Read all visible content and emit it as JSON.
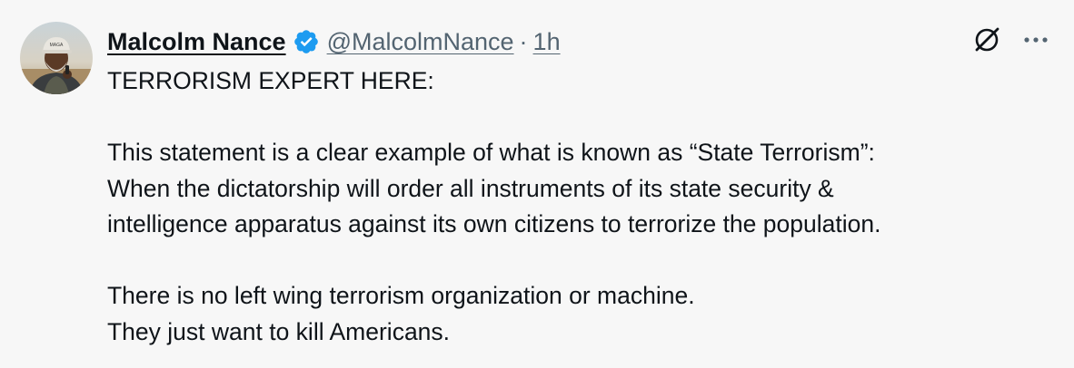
{
  "author": {
    "display_name": "Malcolm Nance",
    "handle": "@MalcolmNance",
    "separator": "·",
    "time": "1h",
    "verified": true
  },
  "colors": {
    "background": "#f7f7f7",
    "text": "#0f1419",
    "secondary": "#536471",
    "verified_badge": "#1d9bf0"
  },
  "icons": {
    "grok": "grok-icon",
    "more": "more-icon",
    "verified": "verified-badge-icon"
  },
  "tweet": {
    "lines": [
      "TERRORISM EXPERT HERE:",
      "",
      "This statement is a clear example of what is known as “State Terrorism”:",
      "When the dictatorship will order all instruments of its state security &",
      "intelligence apparatus against its own citizens to terrorize the population.",
      "",
      "There is no left wing terrorism organization or machine.",
      "They just want to kill Americans."
    ]
  }
}
